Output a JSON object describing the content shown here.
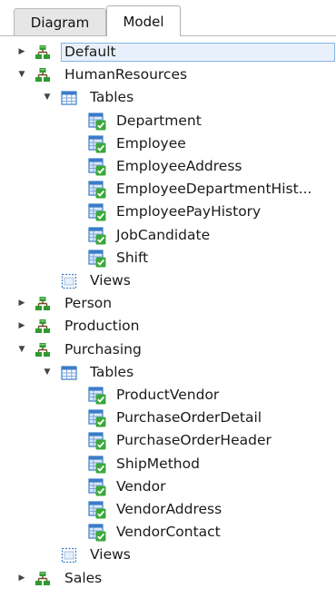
{
  "tabs": [
    {
      "label": "Diagram",
      "active": false
    },
    {
      "label": "Model",
      "active": true
    }
  ],
  "tree": {
    "rows": [
      {
        "label": "Default",
        "kind": "schema",
        "level": 0,
        "expanded": false,
        "selected": true
      },
      {
        "label": "HumanResources",
        "kind": "schema",
        "level": 0,
        "expanded": true
      },
      {
        "label": "Tables",
        "kind": "folder",
        "level": 1,
        "expanded": true
      },
      {
        "label": "Department",
        "kind": "table",
        "level": 2
      },
      {
        "label": "Employee",
        "kind": "table",
        "level": 2
      },
      {
        "label": "EmployeeAddress",
        "kind": "table",
        "level": 2
      },
      {
        "label": "EmployeeDepartmentHist...",
        "kind": "table",
        "level": 2
      },
      {
        "label": "EmployeePayHistory",
        "kind": "table",
        "level": 2
      },
      {
        "label": "JobCandidate",
        "kind": "table",
        "level": 2
      },
      {
        "label": "Shift",
        "kind": "table",
        "level": 2
      },
      {
        "label": "Views",
        "kind": "views",
        "level": 1
      },
      {
        "label": "Person",
        "kind": "schema",
        "level": 0,
        "expanded": false
      },
      {
        "label": "Production",
        "kind": "schema",
        "level": 0,
        "expanded": false
      },
      {
        "label": "Purchasing",
        "kind": "schema",
        "level": 0,
        "expanded": true
      },
      {
        "label": "Tables",
        "kind": "folder",
        "level": 1,
        "expanded": true
      },
      {
        "label": "ProductVendor",
        "kind": "table",
        "level": 2
      },
      {
        "label": "PurchaseOrderDetail",
        "kind": "table",
        "level": 2
      },
      {
        "label": "PurchaseOrderHeader",
        "kind": "table",
        "level": 2
      },
      {
        "label": "ShipMethod",
        "kind": "table",
        "level": 2
      },
      {
        "label": "Vendor",
        "kind": "table",
        "level": 2
      },
      {
        "label": "VendorAddress",
        "kind": "table",
        "level": 2
      },
      {
        "label": "VendorContact",
        "kind": "table",
        "level": 2
      },
      {
        "label": "Views",
        "kind": "views",
        "level": 1
      },
      {
        "label": "Sales",
        "kind": "schema",
        "level": 0,
        "expanded": false
      }
    ]
  },
  "colors": {
    "schema_green": "#2f9a2f",
    "table_blue": "#3a7cc8",
    "check_green": "#3aa83a",
    "selection": "#e8f1fb"
  }
}
